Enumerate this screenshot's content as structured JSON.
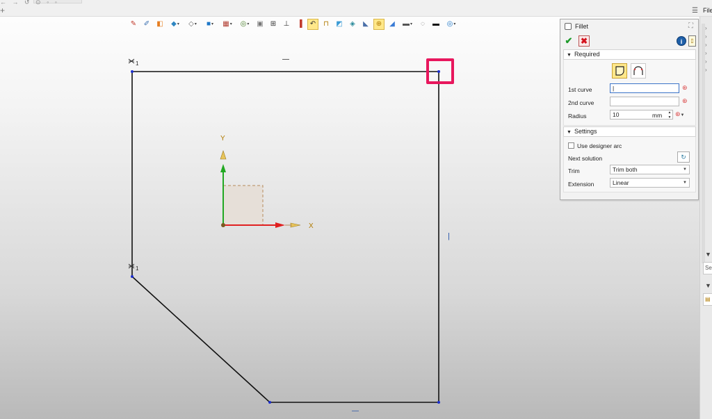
{
  "toolbar": {
    "items": [
      {
        "icon": "magic-wand-icon",
        "glyph": "✎",
        "color": "#c0392b"
      },
      {
        "icon": "sketch-tools-icon",
        "glyph": "✐",
        "color": "#3a6fb0"
      },
      {
        "icon": "object-icon",
        "glyph": "◧",
        "color": "#e67e22"
      },
      {
        "icon": "cube-icon",
        "glyph": "◆",
        "color": "#2e86c1",
        "dropdown": true
      },
      {
        "icon": "view-cube-icon",
        "glyph": "◇",
        "color": "#666",
        "dropdown": true
      },
      {
        "icon": "plane-icon",
        "glyph": "■",
        "color": "#1f78c8",
        "dropdown": true
      },
      {
        "icon": "grid-icon",
        "glyph": "▦",
        "color": "#b03a2e",
        "dropdown": true
      },
      {
        "icon": "snap-icon",
        "glyph": "◎",
        "color": "#4a7f2a",
        "dropdown": true
      },
      {
        "icon": "box-select-icon",
        "glyph": "▣",
        "color": "#777"
      },
      {
        "icon": "dimension-icon",
        "glyph": "⊞",
        "color": "#333"
      },
      {
        "icon": "align-icon",
        "glyph": "⊥",
        "color": "#333"
      },
      {
        "icon": "color-bars-icon",
        "glyph": "▐",
        "color": "#c0392b"
      },
      {
        "icon": "curve-tool-icon",
        "glyph": "↶",
        "color": "#333",
        "active": true
      },
      {
        "icon": "stamp-icon",
        "glyph": "⊓",
        "color": "#b07a00"
      },
      {
        "icon": "paint-icon",
        "glyph": "◩",
        "color": "#3a9bd5"
      },
      {
        "icon": "layers-icon",
        "glyph": "◈",
        "color": "#2a8a9b"
      },
      {
        "icon": "shape-icon",
        "glyph": "◣",
        "color": "#4a6fa8"
      },
      {
        "icon": "target-icon",
        "glyph": "⊕",
        "color": "#b07a00",
        "active": true
      },
      {
        "icon": "slice-icon",
        "glyph": "◢",
        "color": "#3a7bd5"
      },
      {
        "icon": "display-icon",
        "glyph": "▬",
        "color": "#555",
        "dropdown": true
      },
      {
        "icon": "dotted-circle-icon",
        "glyph": "◌",
        "color": "#666"
      },
      {
        "icon": "line-icon",
        "glyph": "▬",
        "color": "#111"
      },
      {
        "icon": "selection-icon",
        "glyph": "◎",
        "color": "#1f78c8",
        "dropdown": true
      }
    ]
  },
  "topbar": {
    "menu": "File",
    "chrome_glyphs": "← → ↺ ⊙ ◦ ◦"
  },
  "sketch": {
    "handle_labels": [
      "—",
      "|",
      "—"
    ],
    "axis_labels": {
      "x": "X",
      "y": "Y"
    }
  },
  "panel": {
    "title": "Fillet",
    "required_header": "Required",
    "first_curve_label": "1st curve",
    "first_curve_value": "|",
    "second_curve_label": "2nd curve",
    "second_curve_value": "",
    "radius_label": "Radius",
    "radius_value": "10",
    "radius_unit": "mm",
    "settings_header": "Settings",
    "designer_arc_label": "Use designer arc",
    "designer_arc_checked": false,
    "next_solution_label": "Next solution",
    "trim_label": "Trim",
    "trim_value": "Trim both",
    "extension_label": "Extension",
    "extension_value": "Linear"
  },
  "right_strip": {
    "search_stub": "Se"
  },
  "colors": {
    "highlight": "#e8175d",
    "x_axis": "#e02020",
    "y_axis": "#22a822",
    "vertex": "#1c2fd0"
  }
}
